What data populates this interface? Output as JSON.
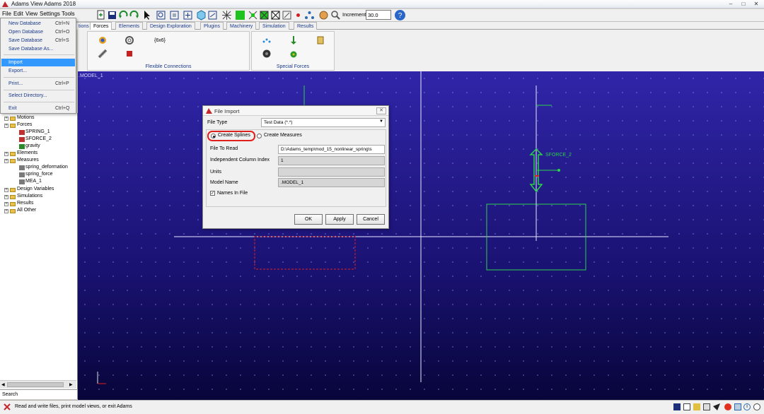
{
  "window": {
    "title": "Adams View Adams 2018"
  },
  "menubar": {
    "items": [
      "File",
      "Edit",
      "View",
      "Settings",
      "Tools"
    ]
  },
  "toolbar": {
    "increment_label": "Increment",
    "increment_value": "30.0"
  },
  "ribbon": {
    "tabs": [
      "tions",
      "Forces",
      "Elements",
      "Design Exploration",
      "Plugins",
      "Machinery",
      "Simulation",
      "Results"
    ],
    "active_tab": "Forces",
    "groups": [
      "Flexible Connections",
      "Special Forces"
    ]
  },
  "file_menu": {
    "items": [
      {
        "label": "New Database",
        "shortcut": "Ctrl+N"
      },
      {
        "label": "Open Database",
        "shortcut": "Ctrl+O"
      },
      {
        "label": "Save Database",
        "shortcut": "Ctrl+S"
      },
      {
        "label": "Save Database As...",
        "shortcut": ""
      },
      {
        "label": "Import",
        "shortcut": ""
      },
      {
        "label": "Export...",
        "shortcut": ""
      },
      {
        "label": "Print...",
        "shortcut": "Ctrl+P"
      },
      {
        "label": "Select Directory...",
        "shortcut": ""
      },
      {
        "label": "Exit",
        "shortcut": "Ctrl+Q"
      }
    ],
    "selected": "Import"
  },
  "tree": {
    "items": [
      {
        "label": "Motions"
      },
      {
        "label": "Forces"
      },
      {
        "label": "SPRING_1"
      },
      {
        "label": "SFORCE_2"
      },
      {
        "label": "gravity"
      },
      {
        "label": "Elements"
      },
      {
        "label": "Measures"
      },
      {
        "label": "spring_deformation"
      },
      {
        "label": "spring_force"
      },
      {
        "label": "MEA_1"
      },
      {
        "label": "Design Variables"
      },
      {
        "label": "Simulations"
      },
      {
        "label": "Results"
      },
      {
        "label": "All Other"
      }
    ],
    "search_label": "Search"
  },
  "viewport": {
    "model_label": ".MODEL_1",
    "sforce_label": "SFORCE_2"
  },
  "dialog": {
    "title": "File Import",
    "file_type_label": "File Type",
    "file_type_value": "Test Data (*.*)",
    "radio_create_splines": "Create Splines",
    "radio_create_measures": "Create Measures",
    "file_to_read_label": "File To Read",
    "file_to_read_value": "D:\\Adams_temp\\mod_15_nonlinear_spring\\s",
    "indep_col_label": "Independent Column Index",
    "indep_col_value": "1",
    "units_label": "Units",
    "units_value": "",
    "model_name_label": "Model Name",
    "model_name_value": ".MODEL_1",
    "names_in_file_label": "Names In File",
    "ok": "OK",
    "apply": "Apply",
    "cancel": "Cancel"
  },
  "statusbar": {
    "text": "Read and write files, print model views, or exit Adams"
  },
  "colors": {
    "viewport_top": "#3025a8",
    "viewport_bottom": "#08053a",
    "highlight": "#3399ff",
    "annotation_red": "#e0201c",
    "geometry_green": "#2bd24a"
  }
}
